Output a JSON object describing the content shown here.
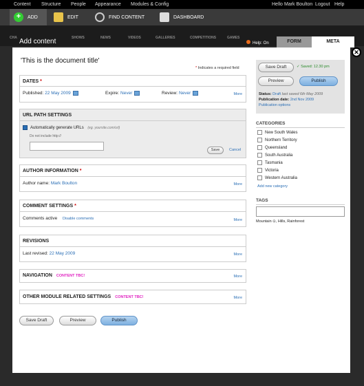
{
  "topbar": {
    "nav": [
      "Content",
      "Structure",
      "People",
      "Appearance",
      "Modules & Config"
    ],
    "user": [
      "Hello",
      "Mark Boulton",
      "Logout",
      "Help"
    ]
  },
  "toolbar": {
    "add": "ADD",
    "edit": "EDIT",
    "find": "FIND CONTENT",
    "dashboard": "DASHBOARD"
  },
  "bgnav": [
    "CHA",
    "SHOWS",
    "NEWS",
    "VIDEOS",
    "GALLERIES",
    "COMPETITIONS",
    "GAMES"
  ],
  "modal": {
    "title": "Add content",
    "help": "Help: On",
    "tabs": [
      "FORM",
      "META"
    ],
    "close": "✕"
  },
  "form": {
    "doc_title": "'This is the document title'",
    "required_note": "Indicates a required field",
    "dates": {
      "heading": "DATES",
      "published_label": "Published:",
      "published": "22 May 2009",
      "expire_label": "Expire:",
      "expire": "Never",
      "review_label": "Review:",
      "review": "Never",
      "more": "More"
    },
    "url": {
      "heading": "URL PATH SETTINGS",
      "auto_label": "Automatically generate URLs",
      "example": "(eg. yoursite.com/url)",
      "hint": "Do not include http://",
      "save": "Save",
      "cancel": "Cancel"
    },
    "author": {
      "heading": "AUTHOR INFORMATION",
      "label": "Author name:",
      "name": "Mark Boulton",
      "more": "More"
    },
    "comment": {
      "heading": "COMMENT SETTINGS",
      "label": "Comments active",
      "disable": "Disable comments",
      "more": "More"
    },
    "revisions": {
      "heading": "REVISIONS",
      "label": "Last revised:",
      "date": "22 May 2009",
      "more": "More"
    },
    "navigation": {
      "heading": "NAVIGATION",
      "tbc": "CONTENT TBC!",
      "more": "More"
    },
    "other": {
      "heading": "OTHER MODULE RELATED SETTINGS",
      "tbc": "CONTENT TBC!",
      "more": "More"
    },
    "buttons": {
      "save_draft": "Save Draft",
      "preview": "Preview",
      "publish": "Publish"
    }
  },
  "sidebar": {
    "save_draft": "Save Draft",
    "saved": "✓ Saved: 12.30 pm",
    "preview": "Preview",
    "publish": "Publish",
    "status_label": "Status:",
    "status": "Draft",
    "last_saved": "last saved 6th May 2009",
    "pub_label": "Publication date:",
    "pub_date": "2nd Nov 2009",
    "pub_options": "Publication options",
    "categories_heading": "CATEGORIES",
    "categories": [
      "New South Wales",
      "Northern Territory",
      "Queensland",
      "South Australia",
      "Tasmania",
      "Victoria",
      "Western Australia"
    ],
    "add_category": "Add new category",
    "tags_heading": "TAGS",
    "tags": "Mountain ⊙, Hills, Rainforest"
  }
}
